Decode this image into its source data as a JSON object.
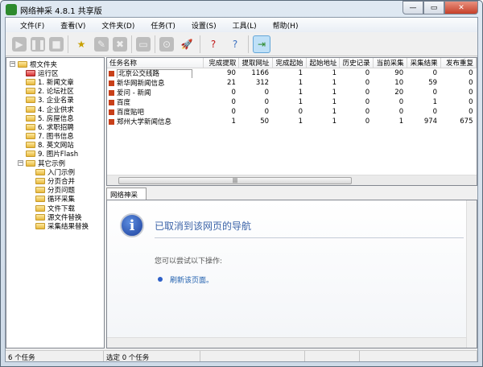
{
  "window": {
    "title": "网络神采 4.8.1 共享版",
    "minimize": "—",
    "maximize": "▭",
    "close": "✕"
  },
  "menu": [
    "文件(F)",
    "查看(V)",
    "文件夹(D)",
    "任务(T)",
    "设置(S)",
    "工具(L)",
    "帮助(H)"
  ],
  "toolbar": [
    {
      "icon": "play-icon",
      "glyph": "▶",
      "enabled": false
    },
    {
      "icon": "pause-icon",
      "glyph": "❚❚",
      "enabled": false
    },
    {
      "icon": "stop-icon",
      "glyph": "■",
      "enabled": false
    },
    {
      "icon": "new-task-icon",
      "glyph": "★",
      "enabled": true
    },
    {
      "icon": "edit-icon",
      "glyph": "✎",
      "enabled": false
    },
    {
      "icon": "delete-icon",
      "glyph": "✖",
      "enabled": false
    },
    {
      "icon": "save-icon",
      "glyph": "▭",
      "enabled": false
    },
    {
      "icon": "record-icon",
      "glyph": "⊙",
      "enabled": false
    },
    {
      "icon": "launch-icon",
      "glyph": "🚀",
      "enabled": true
    },
    {
      "icon": "help-icon",
      "glyph": "?",
      "enabled": true
    },
    {
      "icon": "whats-this-icon",
      "glyph": "?",
      "enabled": true
    },
    {
      "icon": "exit-icon",
      "glyph": "⇥",
      "enabled": true
    }
  ],
  "tree": {
    "root": "根文件夹",
    "items": [
      {
        "label": "运行区",
        "level": 1,
        "red": true
      },
      {
        "label": "1. 新闻文章",
        "level": 1
      },
      {
        "label": "2. 论坛社区",
        "level": 1
      },
      {
        "label": "3. 企业名录",
        "level": 1
      },
      {
        "label": "4. 企业供求",
        "level": 1
      },
      {
        "label": "5. 房屋信息",
        "level": 1
      },
      {
        "label": "6. 求职招聘",
        "level": 1
      },
      {
        "label": "7. 图书信息",
        "level": 1
      },
      {
        "label": "8. 英文网站",
        "level": 1
      },
      {
        "label": "9. 图片Flash",
        "level": 1
      },
      {
        "label": "其它示例",
        "level": 1,
        "expand": true
      },
      {
        "label": "入门示例",
        "level": 2
      },
      {
        "label": "分页合并",
        "level": 2
      },
      {
        "label": "分页问题",
        "level": 2
      },
      {
        "label": "循环采集",
        "level": 2
      },
      {
        "label": "文件下载",
        "level": 2
      },
      {
        "label": "源文件替换",
        "level": 2
      },
      {
        "label": "采集结果替换",
        "level": 2
      }
    ]
  },
  "tasks": {
    "columns": [
      "任务名称",
      "完成提取",
      "提取网址",
      "完成起始",
      "起始地址",
      "历史记录",
      "当前采集",
      "采集结果",
      "发布重复"
    ],
    "rows": [
      [
        "北京公交线路",
        "90",
        "1166",
        "1",
        "1",
        "0",
        "90",
        "0",
        "0"
      ],
      [
        "新华网新闻信息",
        "21",
        "312",
        "1",
        "1",
        "0",
        "10",
        "59",
        "0"
      ],
      [
        "爱问 - 新闻",
        "0",
        "0",
        "1",
        "1",
        "0",
        "20",
        "0",
        "0"
      ],
      [
        "百度",
        "0",
        "0",
        "1",
        "1",
        "0",
        "0",
        "1",
        "0"
      ],
      [
        "百度贴吧",
        "0",
        "0",
        "0",
        "1",
        "0",
        "0",
        "0",
        "0"
      ],
      [
        "郑州大学新闻信息",
        "1",
        "50",
        "1",
        "1",
        "0",
        "1",
        "974",
        "675"
      ]
    ]
  },
  "browser": {
    "tab": "网络神采",
    "heading": "已取消到该网页的导航",
    "prompt": "您可以尝试以下操作:",
    "link": "刷新该页面。"
  },
  "status": {
    "count": "6 个任务",
    "selected": "选定 0 个任务"
  }
}
